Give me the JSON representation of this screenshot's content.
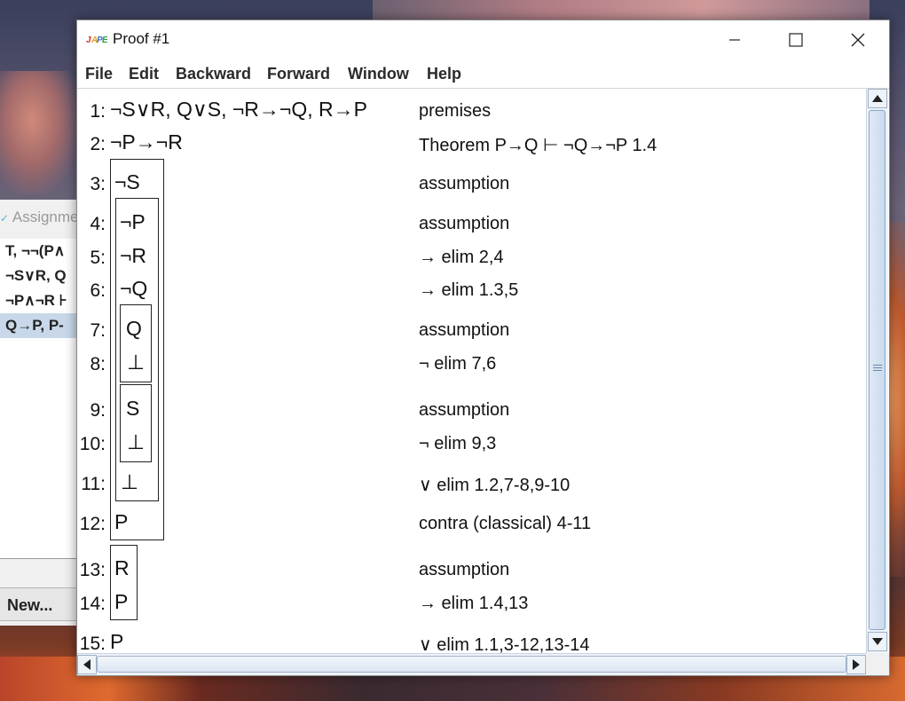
{
  "background_window": {
    "title": "Assignme",
    "items": [
      {
        "label": "T, ¬¬(P∧"
      },
      {
        "label": "¬S∨R, Q"
      },
      {
        "label": "¬P∧¬R ⊦"
      },
      {
        "label": "Q→P, P-"
      }
    ],
    "selected_index": 3,
    "new_button": "New..."
  },
  "window": {
    "title": "Proof #1",
    "app_icon": "jape-logo-icon"
  },
  "menu": [
    "File",
    "Edit",
    "Backward",
    "Forward",
    "Window",
    "Help"
  ],
  "proof": [
    {
      "num": "1:",
      "formula": "¬S∨R, Q∨S, ¬R→¬Q, R→P",
      "justification": "premises"
    },
    {
      "num": "2:",
      "formula": "¬P→¬R",
      "justification": "Theorem P→Q ⊢ ¬Q→¬P 1.4"
    },
    {
      "num": "3:",
      "formula": "¬S",
      "justification": "assumption"
    },
    {
      "num": "4:",
      "formula": "¬P",
      "justification": "assumption"
    },
    {
      "num": "5:",
      "formula": "¬R",
      "justification": "→ elim 2,4"
    },
    {
      "num": "6:",
      "formula": "¬Q",
      "justification": "→ elim 1.3,5"
    },
    {
      "num": "7:",
      "formula": "Q",
      "justification": "assumption"
    },
    {
      "num": "8:",
      "formula": "⊥",
      "justification": "¬ elim 7,6"
    },
    {
      "num": "9:",
      "formula": "S",
      "justification": "assumption"
    },
    {
      "num": "10:",
      "formula": "⊥",
      "justification": "¬ elim 9,3"
    },
    {
      "num": "11:",
      "formula": "⊥",
      "justification": "∨ elim 1.2,7-8,9-10"
    },
    {
      "num": "12:",
      "formula": "P",
      "justification": "contra (classical) 4-11"
    },
    {
      "num": "13:",
      "formula": "R",
      "justification": "assumption"
    },
    {
      "num": "14:",
      "formula": "P",
      "justification": "→ elim 1.4,13"
    },
    {
      "num": "15:",
      "formula": "P",
      "justification": "∨ elim 1.1,3-12,13-14"
    }
  ]
}
